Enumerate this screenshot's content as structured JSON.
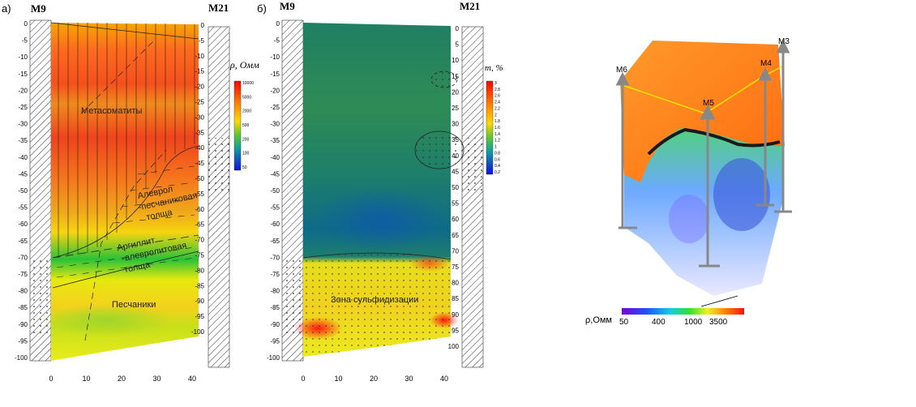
{
  "panel_a": {
    "letter": "а)",
    "left_well": "М9",
    "right_well": "М21",
    "y_ticks": [
      "0",
      "-5",
      "-10",
      "-15",
      "-20",
      "-25",
      "-30",
      "-35",
      "-40",
      "-45",
      "-50",
      "-55",
      "-60",
      "-65",
      "-70",
      "-75",
      "-80",
      "-85",
      "-90",
      "-95",
      "-100"
    ],
    "x_ticks": [
      "0",
      "10",
      "20",
      "30",
      "40"
    ],
    "zones": {
      "metasomatites": "Метасоматиты",
      "silt_sand_1": "Алеврол",
      "silt_sand_2": "-песчаниковая",
      "silt_sand_3": "толща",
      "argillite_1": "Аргиллит",
      "argillite_2": "-алевролитовая",
      "argillite_3": "толща",
      "sandstones": "Песчаники"
    },
    "legend": {
      "title": "ρ, Омм",
      "ticks": [
        "10000",
        "5000",
        "2000",
        "500",
        "200",
        "100",
        "50"
      ]
    }
  },
  "panel_b": {
    "letter": "б)",
    "left_well": "М9",
    "right_well": "М21",
    "y_ticks": [
      "0",
      "-5",
      "-10",
      "-15",
      "-20",
      "-25",
      "-30",
      "-35",
      "-40",
      "-45",
      "-50",
      "-55",
      "-60",
      "-65",
      "-70",
      "-75",
      "-80",
      "-85",
      "-90",
      "-95",
      "-100"
    ],
    "right_ticks": [
      "0",
      "5",
      "10",
      "15",
      "20",
      "25",
      "30",
      "35",
      "40",
      "45",
      "50",
      "55",
      "60",
      "65",
      "70",
      "75",
      "80",
      "85",
      "90",
      "95",
      "100"
    ],
    "x_ticks": [
      "0",
      "10",
      "20",
      "30",
      "40"
    ],
    "zone": "Зона сульфидизации",
    "legend": {
      "title": "m, %",
      "ticks": [
        "3",
        "2.8",
        "2.6",
        "2.4",
        "2.2",
        "2",
        "1.8",
        "1.6",
        "1.4",
        "1.2",
        "1",
        "0.8",
        "0.6",
        "0.4",
        "0.2"
      ]
    }
  },
  "panel_3d": {
    "wells": [
      "М6",
      "М5",
      "М4",
      "М3"
    ],
    "legend": {
      "title": "ρ,Омм",
      "ticks": [
        "50",
        "400",
        "1000",
        "3500"
      ]
    }
  }
}
